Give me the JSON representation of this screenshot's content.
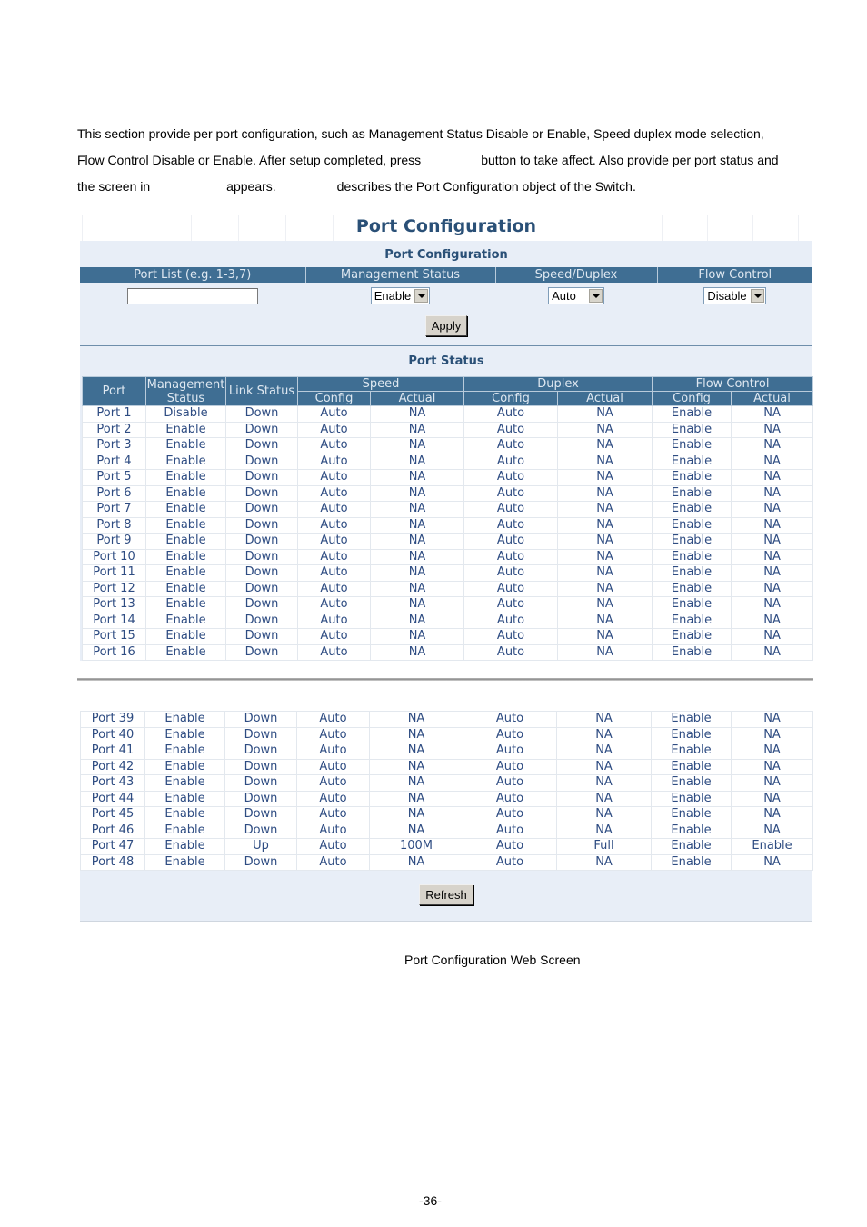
{
  "doc": {
    "paragraph": [
      "This section provide per port configuration, such as Management Status Disable or Enable, Speed duplex mode selection,",
      [
        "Flow Control Disable or Enable. After setup completed, press",
        "button to take affect. Also provide per port status and"
      ],
      [
        "the screen in",
        "appears.",
        "describes the Port Configuration object of the Switch."
      ]
    ],
    "caption": "Port Configuration Web Screen",
    "page_number": "-36-"
  },
  "ui": {
    "title": "Port Configuration",
    "config_section": {
      "title": "Port Configuration",
      "headers": [
        "Port List (e.g. 1-3,7)",
        "Management Status",
        "Speed/Duplex",
        "Flow Control"
      ],
      "port_list_value": "",
      "management_status": "Enable",
      "speed_duplex": "Auto",
      "flow_control": "Disable",
      "apply_label": "Apply"
    },
    "status_section": {
      "title": "Port Status",
      "headers": {
        "port": "Port",
        "management_status": "Management Status",
        "link_status": "Link Status",
        "speed": "Speed",
        "duplex": "Duplex",
        "flow_control": "Flow Control",
        "config": "Config",
        "actual": "Actual"
      },
      "rows_upper": [
        [
          "Port 1",
          "Disable",
          "Down",
          "Auto",
          "NA",
          "Auto",
          "NA",
          "Enable",
          "NA"
        ],
        [
          "Port 2",
          "Enable",
          "Down",
          "Auto",
          "NA",
          "Auto",
          "NA",
          "Enable",
          "NA"
        ],
        [
          "Port 3",
          "Enable",
          "Down",
          "Auto",
          "NA",
          "Auto",
          "NA",
          "Enable",
          "NA"
        ],
        [
          "Port 4",
          "Enable",
          "Down",
          "Auto",
          "NA",
          "Auto",
          "NA",
          "Enable",
          "NA"
        ],
        [
          "Port 5",
          "Enable",
          "Down",
          "Auto",
          "NA",
          "Auto",
          "NA",
          "Enable",
          "NA"
        ],
        [
          "Port 6",
          "Enable",
          "Down",
          "Auto",
          "NA",
          "Auto",
          "NA",
          "Enable",
          "NA"
        ],
        [
          "Port 7",
          "Enable",
          "Down",
          "Auto",
          "NA",
          "Auto",
          "NA",
          "Enable",
          "NA"
        ],
        [
          "Port 8",
          "Enable",
          "Down",
          "Auto",
          "NA",
          "Auto",
          "NA",
          "Enable",
          "NA"
        ],
        [
          "Port 9",
          "Enable",
          "Down",
          "Auto",
          "NA",
          "Auto",
          "NA",
          "Enable",
          "NA"
        ],
        [
          "Port 10",
          "Enable",
          "Down",
          "Auto",
          "NA",
          "Auto",
          "NA",
          "Enable",
          "NA"
        ],
        [
          "Port 11",
          "Enable",
          "Down",
          "Auto",
          "NA",
          "Auto",
          "NA",
          "Enable",
          "NA"
        ],
        [
          "Port 12",
          "Enable",
          "Down",
          "Auto",
          "NA",
          "Auto",
          "NA",
          "Enable",
          "NA"
        ],
        [
          "Port 13",
          "Enable",
          "Down",
          "Auto",
          "NA",
          "Auto",
          "NA",
          "Enable",
          "NA"
        ],
        [
          "Port 14",
          "Enable",
          "Down",
          "Auto",
          "NA",
          "Auto",
          "NA",
          "Enable",
          "NA"
        ],
        [
          "Port 15",
          "Enable",
          "Down",
          "Auto",
          "NA",
          "Auto",
          "NA",
          "Enable",
          "NA"
        ],
        [
          "Port 16",
          "Enable",
          "Down",
          "Auto",
          "NA",
          "Auto",
          "NA",
          "Enable",
          "NA"
        ]
      ],
      "rows_lower": [
        [
          "Port 39",
          "Enable",
          "Down",
          "Auto",
          "NA",
          "Auto",
          "NA",
          "Enable",
          "NA"
        ],
        [
          "Port 40",
          "Enable",
          "Down",
          "Auto",
          "NA",
          "Auto",
          "NA",
          "Enable",
          "NA"
        ],
        [
          "Port 41",
          "Enable",
          "Down",
          "Auto",
          "NA",
          "Auto",
          "NA",
          "Enable",
          "NA"
        ],
        [
          "Port 42",
          "Enable",
          "Down",
          "Auto",
          "NA",
          "Auto",
          "NA",
          "Enable",
          "NA"
        ],
        [
          "Port 43",
          "Enable",
          "Down",
          "Auto",
          "NA",
          "Auto",
          "NA",
          "Enable",
          "NA"
        ],
        [
          "Port 44",
          "Enable",
          "Down",
          "Auto",
          "NA",
          "Auto",
          "NA",
          "Enable",
          "NA"
        ],
        [
          "Port 45",
          "Enable",
          "Down",
          "Auto",
          "NA",
          "Auto",
          "NA",
          "Enable",
          "NA"
        ],
        [
          "Port 46",
          "Enable",
          "Down",
          "Auto",
          "NA",
          "Auto",
          "NA",
          "Enable",
          "NA"
        ],
        [
          "Port 47",
          "Enable",
          "Up",
          "Auto",
          "100M",
          "Auto",
          "Full",
          "Enable",
          "Enable"
        ],
        [
          "Port 48",
          "Enable",
          "Down",
          "Auto",
          "NA",
          "Auto",
          "NA",
          "Enable",
          "NA"
        ]
      ],
      "refresh_label": "Refresh"
    }
  }
}
